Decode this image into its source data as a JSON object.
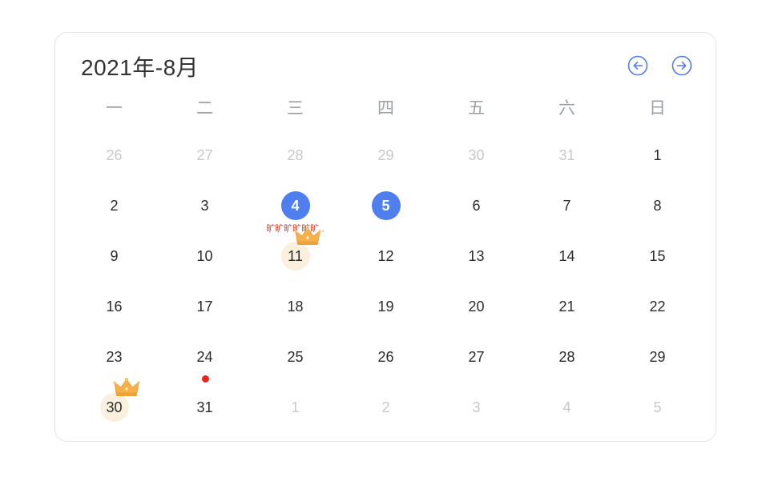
{
  "calendar": {
    "title": "2021年-8月",
    "prev_icon": "arrow-left-circle-icon",
    "next_icon": "arrow-right-circle-icon",
    "accent_color": "#4f7ef0",
    "weekdays": [
      "一",
      "二",
      "三",
      "四",
      "五",
      "六",
      "日"
    ],
    "weeks": [
      [
        {
          "day": "26",
          "muted": true
        },
        {
          "day": "27",
          "muted": true
        },
        {
          "day": "28",
          "muted": true
        },
        {
          "day": "29",
          "muted": true
        },
        {
          "day": "30",
          "muted": true
        },
        {
          "day": "31",
          "muted": true
        },
        {
          "day": "1"
        }
      ],
      [
        {
          "day": "2"
        },
        {
          "day": "3"
        },
        {
          "day": "4",
          "selected": true,
          "note": "旷旷旷旷旷旷.."
        },
        {
          "day": "5",
          "selected": true
        },
        {
          "day": "6"
        },
        {
          "day": "7"
        },
        {
          "day": "8"
        }
      ],
      [
        {
          "day": "9"
        },
        {
          "day": "10"
        },
        {
          "day": "11",
          "crown": true
        },
        {
          "day": "12"
        },
        {
          "day": "13"
        },
        {
          "day": "14"
        },
        {
          "day": "15"
        }
      ],
      [
        {
          "day": "16"
        },
        {
          "day": "17"
        },
        {
          "day": "18"
        },
        {
          "day": "19"
        },
        {
          "day": "20"
        },
        {
          "day": "21"
        },
        {
          "day": "22"
        }
      ],
      [
        {
          "day": "23"
        },
        {
          "day": "24",
          "dot": true
        },
        {
          "day": "25"
        },
        {
          "day": "26"
        },
        {
          "day": "27"
        },
        {
          "day": "28"
        },
        {
          "day": "29"
        }
      ],
      [
        {
          "day": "30",
          "crown": true
        },
        {
          "day": "31"
        },
        {
          "day": "1",
          "muted": true
        },
        {
          "day": "2",
          "muted": true
        },
        {
          "day": "3",
          "muted": true
        },
        {
          "day": "4",
          "muted": true
        },
        {
          "day": "5",
          "muted": true
        }
      ]
    ]
  }
}
